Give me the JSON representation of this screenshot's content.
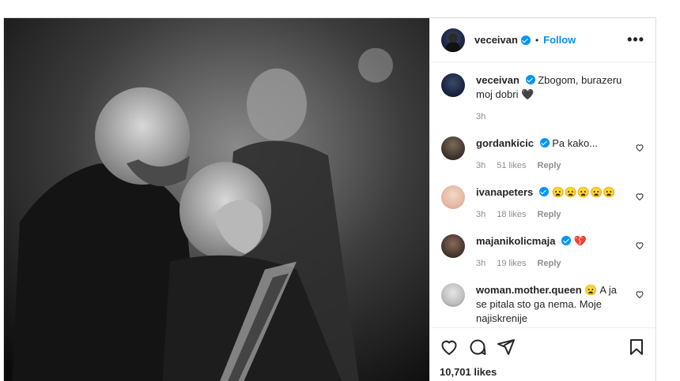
{
  "post": {
    "author": "veceivan",
    "follow_label": "Follow",
    "dot": "•",
    "more_label": "•••",
    "caption": {
      "user": "veceivan",
      "text": "Zbogom, burazeru moj dobri 🖤",
      "time": "3h"
    },
    "likes": "10,701 likes"
  },
  "comments": [
    {
      "user": "gordankicic",
      "text": "Pa kako...",
      "time": "3h",
      "likes": "51 likes",
      "reply": "Reply"
    },
    {
      "user": "ivanapeters",
      "text": "😦😦😦😦😦",
      "time": "3h",
      "likes": "18 likes",
      "reply": "Reply"
    },
    {
      "user": "majanikolicmaja",
      "text": "💔",
      "time": "3h",
      "likes": "19 likes",
      "reply": "Reply"
    },
    {
      "user": "woman.mother.queen",
      "text": "😦 A ja se pitala sto ga nema. Moje najiskrenije",
      "time": "",
      "likes": "",
      "reply": ""
    }
  ],
  "colors": {
    "accent": "#0095f6",
    "text": "#262626",
    "muted": "#8e8e8e",
    "border": "#dbdbdb"
  }
}
